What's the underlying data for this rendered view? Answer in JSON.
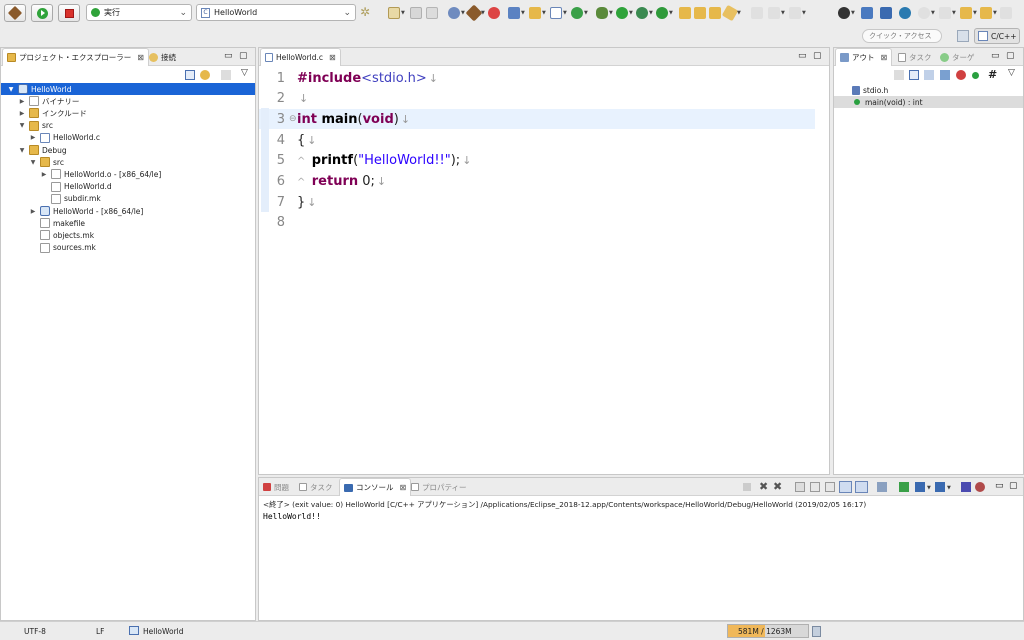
{
  "toolbar": {
    "run_mode": "実行",
    "launch_target": "HelloWorld",
    "quick_access_placeholder": "クイック・アクセス",
    "perspective": "C/C++"
  },
  "explorer": {
    "tabs": [
      {
        "label": "プロジェクト・エクスプローラー"
      },
      {
        "label": "接続"
      }
    ],
    "tree": [
      {
        "label": "HelloWorld",
        "indent": 0,
        "twisty": "▼",
        "icon": "project",
        "selected": true
      },
      {
        "label": "バイナリー",
        "indent": 1,
        "twisty": "▶",
        "icon": "binary"
      },
      {
        "label": "インクルード",
        "indent": 1,
        "twisty": "▶",
        "icon": "include"
      },
      {
        "label": "src",
        "indent": 1,
        "twisty": "▼",
        "icon": "folder"
      },
      {
        "label": "HelloWorld.c",
        "indent": 2,
        "twisty": "▶",
        "icon": "cfile"
      },
      {
        "label": "Debug",
        "indent": 1,
        "twisty": "▼",
        "icon": "folder"
      },
      {
        "label": "src",
        "indent": 2,
        "twisty": "▼",
        "icon": "folder"
      },
      {
        "label": "HelloWorld.o - [x86_64/le]",
        "indent": 3,
        "twisty": "▶",
        "icon": "obj"
      },
      {
        "label": "HelloWorld.d",
        "indent": 3,
        "twisty": "",
        "icon": "file"
      },
      {
        "label": "subdir.mk",
        "indent": 3,
        "twisty": "",
        "icon": "mk"
      },
      {
        "label": "HelloWorld - [x86_64/le]",
        "indent": 2,
        "twisty": "▶",
        "icon": "exe"
      },
      {
        "label": "makefile",
        "indent": 2,
        "twisty": "",
        "icon": "mk"
      },
      {
        "label": "objects.mk",
        "indent": 2,
        "twisty": "",
        "icon": "mk"
      },
      {
        "label": "sources.mk",
        "indent": 2,
        "twisty": "",
        "icon": "mk"
      }
    ]
  },
  "editor": {
    "tab_label": "HelloWorld.c",
    "lines": [
      {
        "num": "1",
        "gutter": "",
        "parts": [
          {
            "t": "#include",
            "c": "kw"
          },
          {
            "t": "<stdio.h>",
            "c": "inc"
          }
        ],
        "ws": "↓"
      },
      {
        "num": "2",
        "gutter": "",
        "parts": [],
        "ws": "↓"
      },
      {
        "num": "3",
        "gutter": "⊖",
        "parts": [
          {
            "t": "int",
            "c": "kw"
          },
          {
            "t": " main",
            "c": "fn"
          },
          {
            "t": "(",
            "c": ""
          },
          {
            "t": "void",
            "c": "kw"
          },
          {
            "t": ")",
            "c": ""
          }
        ],
        "ws": "↓",
        "highlight": true
      },
      {
        "num": "4",
        "gutter": "",
        "parts": [
          {
            "t": "{",
            "c": ""
          }
        ],
        "ws": "↓"
      },
      {
        "num": "5",
        "gutter": "",
        "parts": [
          {
            "t": "^  ",
            "c": "tabmark"
          },
          {
            "t": "printf",
            "c": "fn"
          },
          {
            "t": "(",
            "c": ""
          },
          {
            "t": "\"HelloWorld!!\"",
            "c": "str"
          },
          {
            "t": ");",
            "c": ""
          }
        ],
        "ws": "↓"
      },
      {
        "num": "6",
        "gutter": "",
        "parts": [
          {
            "t": "^  ",
            "c": "tabmark"
          },
          {
            "t": "return",
            "c": "kw"
          },
          {
            "t": " 0;",
            "c": ""
          }
        ],
        "ws": "↓"
      },
      {
        "num": "7",
        "gutter": "",
        "parts": [
          {
            "t": "}",
            "c": ""
          }
        ],
        "ws": "↓"
      },
      {
        "num": "8",
        "gutter": "",
        "parts": [],
        "ws": ""
      }
    ]
  },
  "outline": {
    "tabs": [
      {
        "label": "アウト"
      },
      {
        "label": "タスク"
      },
      {
        "label": "ターゲ"
      }
    ],
    "items": [
      {
        "label": "stdio.h",
        "icon": "include"
      },
      {
        "label": "main(void) : int",
        "icon": "method",
        "selected": true
      }
    ]
  },
  "console": {
    "tabs": [
      {
        "label": "問題"
      },
      {
        "label": "タスク"
      },
      {
        "label": "コンソール"
      },
      {
        "label": "プロパティー"
      }
    ],
    "header": "<終了> (exit value: 0) HelloWorld [C/C++ アプリケーション] /Applications/Eclipse_2018-12.app/Contents/workspace/HelloWorld/Debug/HelloWorld (2019/02/05 16:17)",
    "output": "HelloWorld!!"
  },
  "statusbar": {
    "encoding": "UTF-8",
    "line_delimiter": "LF",
    "project": "HelloWorld",
    "heap": "581M / 1263M",
    "heap_fraction": 0.46
  }
}
